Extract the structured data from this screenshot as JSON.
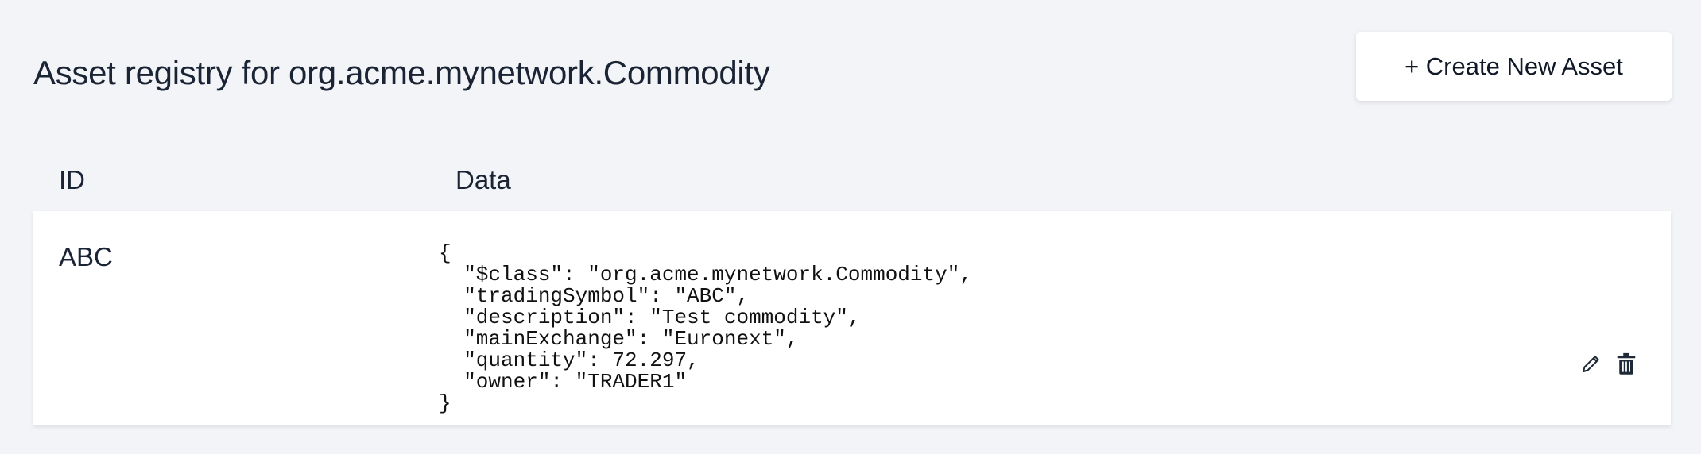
{
  "header": {
    "title": "Asset registry for org.acme.mynetwork.Commodity",
    "create_button_label": "+ Create New Asset"
  },
  "table": {
    "columns": [
      "ID",
      "Data"
    ],
    "rows": [
      {
        "id": "ABC",
        "data": "{\n  \"$class\": \"org.acme.mynetwork.Commodity\",\n  \"tradingSymbol\": \"ABC\",\n  \"description\": \"Test commodity\",\n  \"mainExchange\": \"Euronext\",\n  \"quantity\": 72.297,\n  \"owner\": \"TRADER1\"\n}",
        "actions": {
          "edit_icon": "pencil-icon",
          "delete_icon": "trash-icon"
        }
      }
    ]
  },
  "colors": {
    "background": "#f3f4f7",
    "card": "#ffffff",
    "text": "#1b2435"
  }
}
